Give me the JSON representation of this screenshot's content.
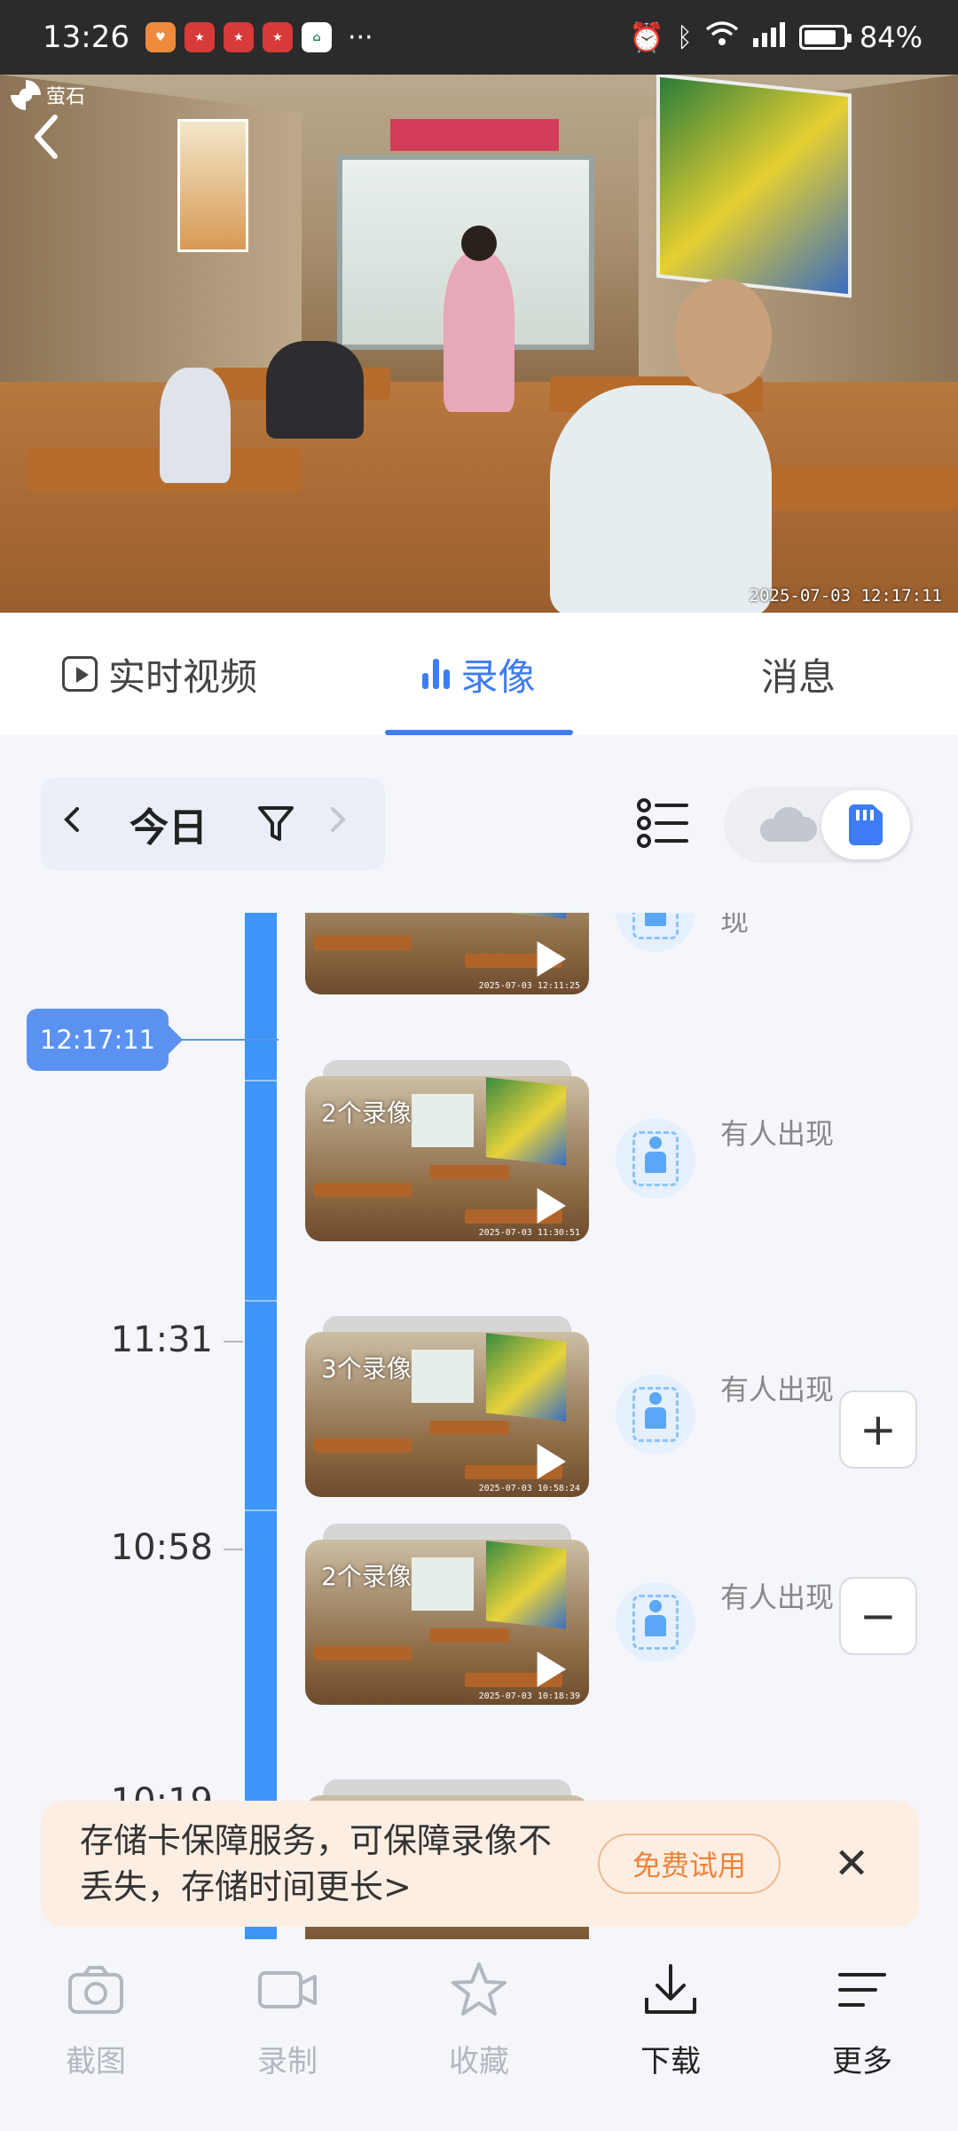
{
  "status_bar": {
    "time": "13:26",
    "battery": "84%",
    "battery_level": 0.84
  },
  "video": {
    "logo": "萤石",
    "timestamp": "2025-07-03 12:17:11"
  },
  "tabs": [
    {
      "label": "实时视频",
      "icon": "play-square-icon",
      "active": false
    },
    {
      "label": "录像",
      "icon": "bar-chart-icon",
      "active": true
    },
    {
      "label": "消息",
      "active": false
    }
  ],
  "date_bar": {
    "label": "今日"
  },
  "timeline": {
    "cursor_time": "12:17:11",
    "time_labels": [
      "11:31",
      "10:58",
      "10:19"
    ],
    "clips": [
      {
        "count": "",
        "thumb_ts": "2025-07-03 12:11:25",
        "event": "现"
      },
      {
        "count": "2个录像",
        "thumb_ts": "2025-07-03 11:30:51",
        "event": "有人出现"
      },
      {
        "count": "3个录像",
        "thumb_ts": "2025-07-03 10:58:24",
        "event": "有人出现"
      },
      {
        "count": "2个录像",
        "thumb_ts": "2025-07-03 10:18:39",
        "event": "有人出现"
      }
    ]
  },
  "zoom": {
    "in": "+",
    "out": "−"
  },
  "promo": {
    "text": "存储卡保障服务，可保障录像不丢失，存储时间更长>",
    "button": "免费试用",
    "close": "✕"
  },
  "toolbar": [
    {
      "label": "截图",
      "icon": "camera-icon",
      "enabled": false
    },
    {
      "label": "录制",
      "icon": "video-camera-icon",
      "enabled": false
    },
    {
      "label": "收藏",
      "icon": "star-icon",
      "enabled": false
    },
    {
      "label": "下载",
      "icon": "download-icon",
      "enabled": true
    },
    {
      "label": "更多",
      "icon": "menu-icon",
      "enabled": true
    }
  ],
  "colors": {
    "accent": "#3d7cf4",
    "timeline": "#3d95f7",
    "promo_bg": "#fdeee3",
    "promo_accent": "#f0833a"
  }
}
